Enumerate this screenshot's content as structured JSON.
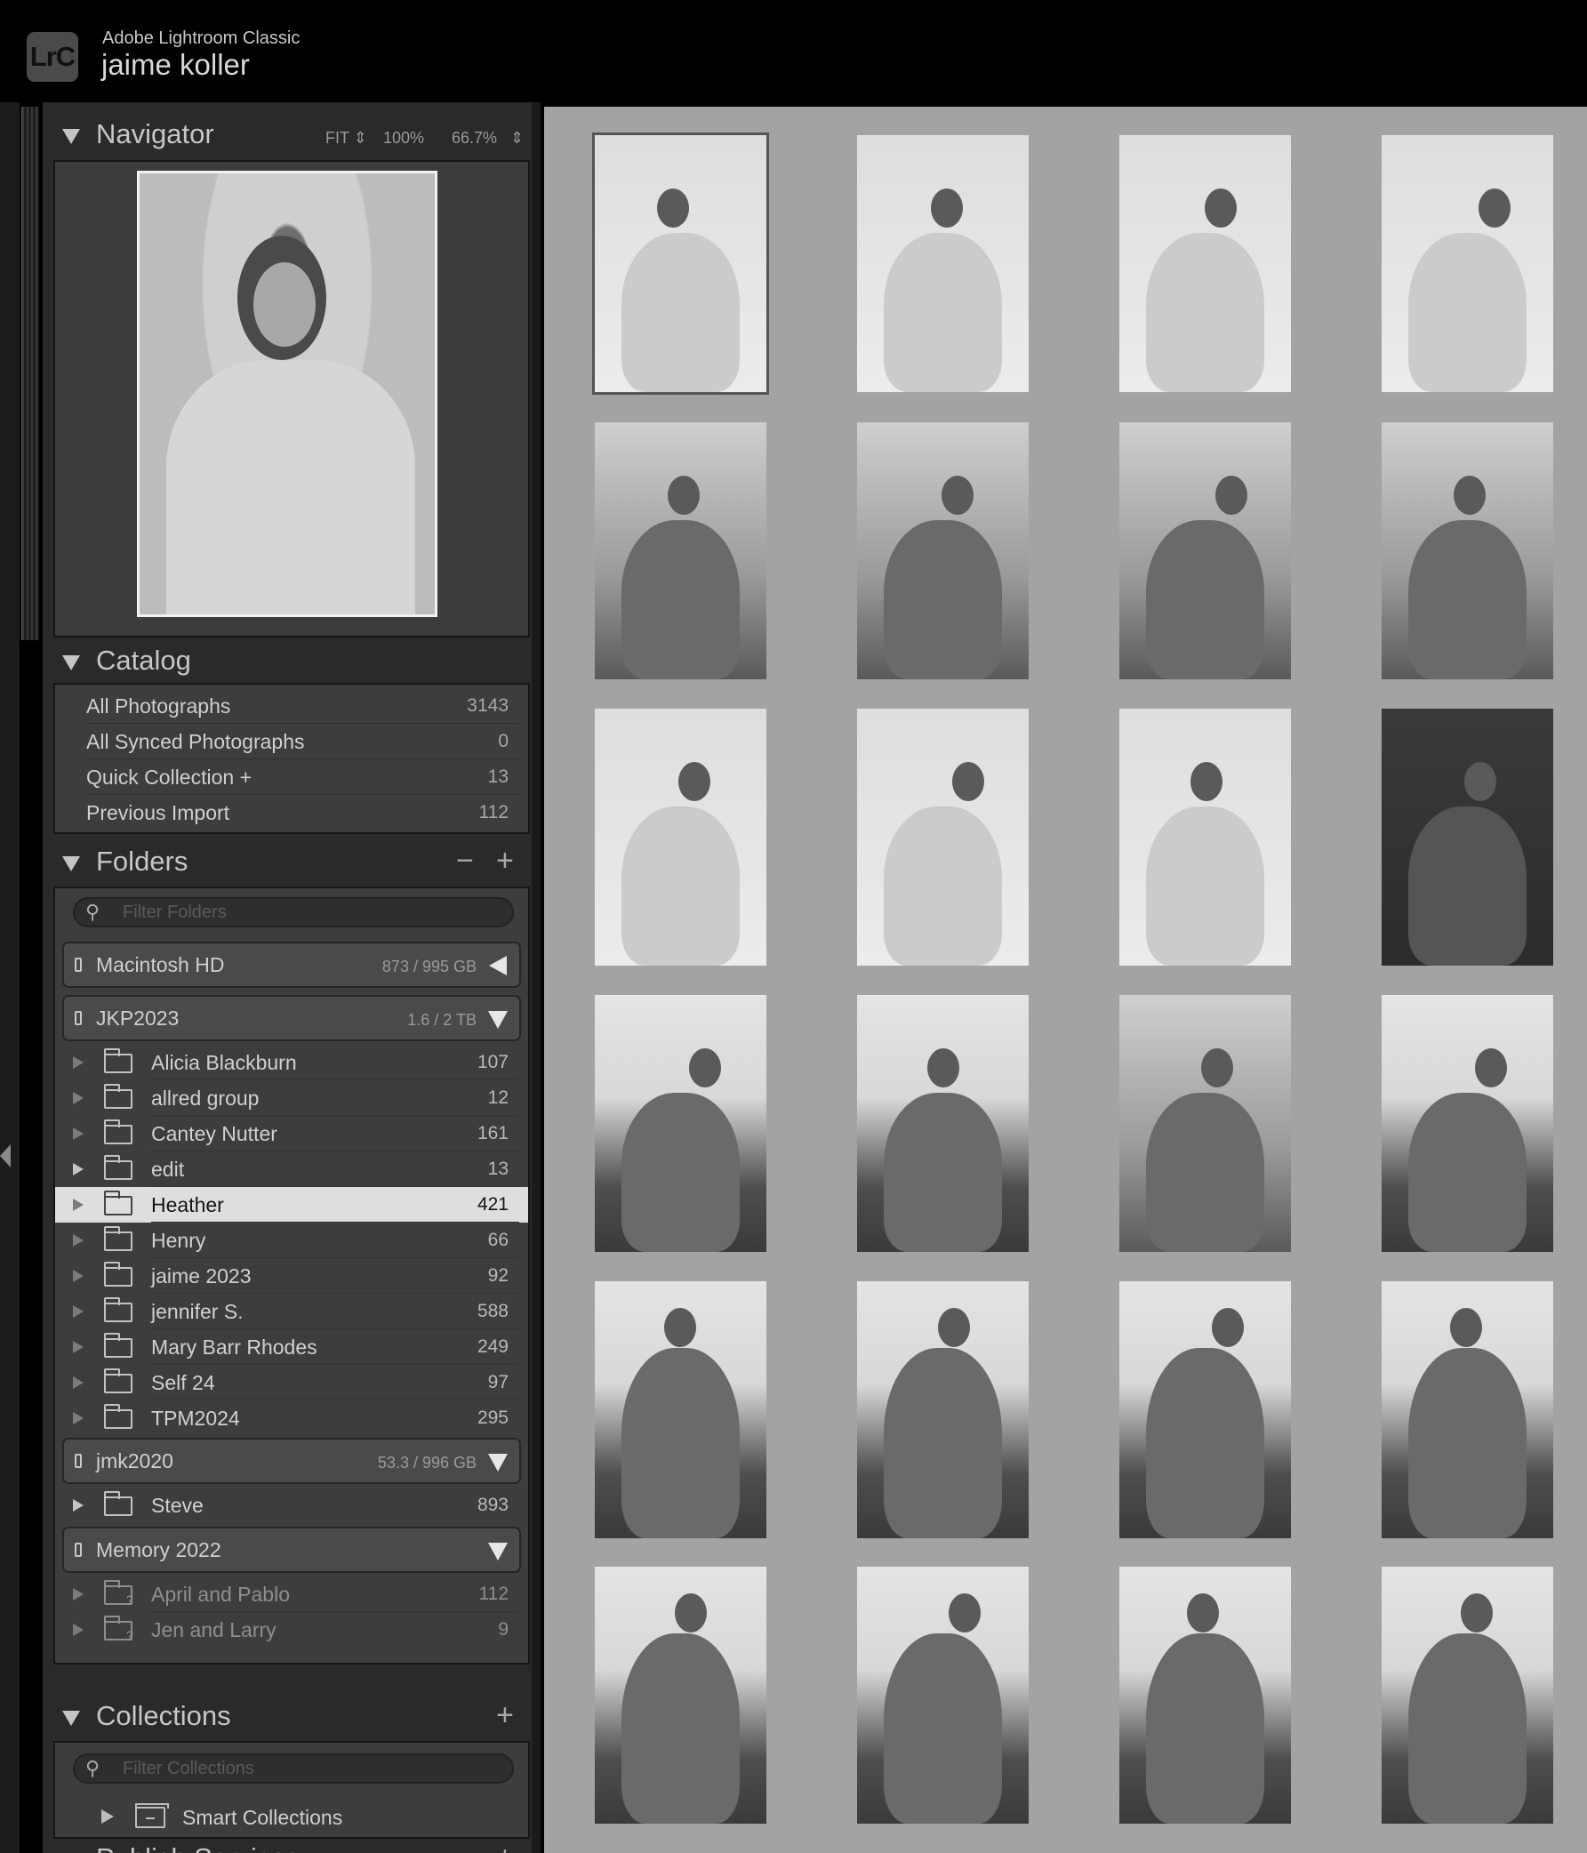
{
  "app": {
    "name": "Adobe Lightroom Classic",
    "logo_text": "LrC",
    "identity_plate": "jaime koller"
  },
  "navigator": {
    "title": "Navigator",
    "zoom_fit": "FIT",
    "zoom_fill": "100%",
    "zoom_custom": "66.7%"
  },
  "catalog": {
    "title": "Catalog",
    "items": [
      {
        "label": "All Photographs",
        "count": "3143"
      },
      {
        "label": "All Synced Photographs",
        "count": "0"
      },
      {
        "label": "Quick Collection  +",
        "count": "13"
      },
      {
        "label": "Previous Import",
        "count": "112"
      }
    ]
  },
  "folders": {
    "title": "Folders",
    "minus": "−",
    "plus": "+",
    "filter_placeholder": "Filter Folders",
    "volumes": [
      {
        "name": "Macintosh HD",
        "size": "873 / 995 GB"
      },
      {
        "name": "JKP2023",
        "size": "1.6 / 2 TB"
      },
      {
        "name": "jmk2020",
        "size": "53.3 / 996 GB"
      },
      {
        "name": "Memory 2022",
        "size": ""
      }
    ],
    "jkp2023_items": [
      {
        "name": "Alicia Blackburn",
        "count": "107"
      },
      {
        "name": "allred group",
        "count": "12"
      },
      {
        "name": "Cantey Nutter",
        "count": "161"
      },
      {
        "name": "edit",
        "count": "13"
      },
      {
        "name": "Heather",
        "count": "421"
      },
      {
        "name": "Henry",
        "count": "66"
      },
      {
        "name": "jaime 2023",
        "count": "92"
      },
      {
        "name": "jennifer S.",
        "count": "588"
      },
      {
        "name": "Mary Barr Rhodes",
        "count": "249"
      },
      {
        "name": "Self 24",
        "count": "97"
      },
      {
        "name": "TPM2024",
        "count": "295"
      }
    ],
    "jmk2020_items": [
      {
        "name": "Steve",
        "count": "893"
      }
    ],
    "memory_items": [
      {
        "name": "April and Pablo",
        "count": "112"
      },
      {
        "name": "Jen and Larry",
        "count": "9"
      }
    ]
  },
  "collections": {
    "title": "Collections",
    "plus": "+",
    "filter_placeholder": "Filter Collections",
    "items": [
      {
        "name": "Smart Collections"
      }
    ]
  },
  "publish": {
    "title": "Publish Services",
    "plus": "+"
  },
  "grid": {
    "selected_index": 0,
    "thumbnail_styles": [
      "light",
      "light",
      "light",
      "light",
      "dark",
      "dark",
      "dark",
      "dark",
      "light",
      "light",
      "light",
      "night",
      "gown",
      "gown",
      "dark",
      "gown",
      "gown",
      "gown",
      "gown",
      "gown",
      "gown",
      "gown",
      "gown",
      "gown"
    ]
  }
}
